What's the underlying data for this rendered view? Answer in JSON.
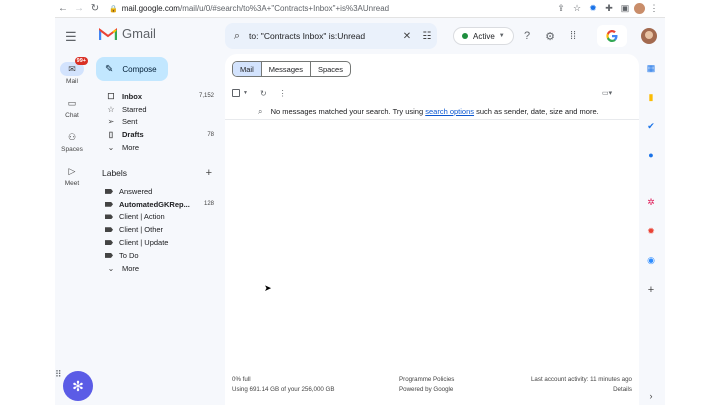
{
  "browser": {
    "url_host": "mail.google.com",
    "url_path": "/mail/u/0/#search/to%3A+\"Contracts+Inbox\"+is%3AUnread"
  },
  "header": {
    "app_name": "Gmail",
    "search_query": "to: \"Contracts Inbox\" is:Unread",
    "status_label": "Active"
  },
  "rail": {
    "mail_label": "Mail",
    "mail_badge": "99+",
    "chat_label": "Chat",
    "spaces_label": "Spaces",
    "meet_label": "Meet"
  },
  "nav": {
    "compose_label": "Compose",
    "items": [
      {
        "label": "Inbox",
        "count": "7,152",
        "icon": "inbox-icon"
      },
      {
        "label": "Starred",
        "count": "",
        "icon": "star-icon"
      },
      {
        "label": "Sent",
        "count": "",
        "icon": "send-icon"
      },
      {
        "label": "Drafts",
        "count": "78",
        "icon": "draft-icon"
      },
      {
        "label": "More",
        "count": "",
        "icon": "chevron-down-icon"
      }
    ],
    "labels_title": "Labels",
    "labels": [
      {
        "label": "Answered",
        "count": ""
      },
      {
        "label": "AutomatedGKRep...",
        "count": "128"
      },
      {
        "label": "Client | Action",
        "count": ""
      },
      {
        "label": "Client | Other",
        "count": ""
      },
      {
        "label": "Client | Update",
        "count": ""
      },
      {
        "label": "To Do",
        "count": ""
      }
    ],
    "labels_more": "More"
  },
  "main": {
    "segments": [
      "Mail",
      "Messages",
      "Spaces"
    ],
    "empty_prefix": "No messages matched your search. Try using",
    "empty_link": "search options",
    "empty_suffix": "such as sender, date, size and more.",
    "footer": {
      "storage_pct": "0% full",
      "storage_detail": "Using 691.14 GB of your 256,000 GB",
      "policies": "Programme Policies",
      "powered": "Powered by Google",
      "activity": "Last account activity: 11 minutes ago",
      "details": "Details"
    }
  },
  "colors": {
    "accent": "#0b57d0",
    "compose_bg": "#c2e7ff",
    "selected_bg": "#d3e3fd",
    "frame_bg": "#f6f8fc"
  }
}
